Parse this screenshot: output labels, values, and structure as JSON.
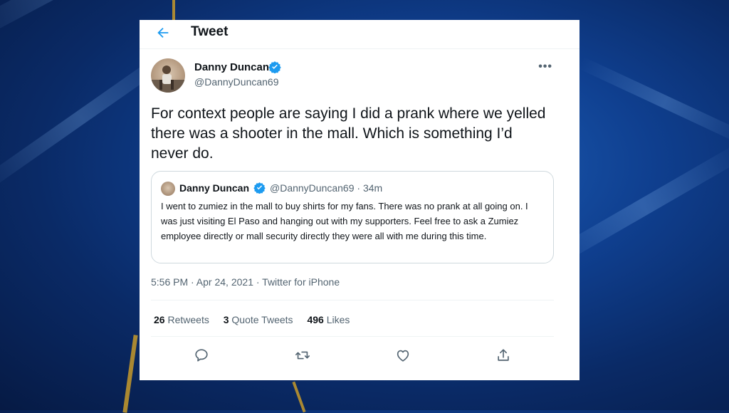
{
  "header": {
    "title": "Tweet"
  },
  "tweet": {
    "author_name": "Danny Duncan",
    "author_handle": "@DannyDuncan69",
    "text": "For context people are saying I did a prank where we yelled there was a shooter in the mall. Which is something I’d never do.",
    "timestamp": "5:56 PM · Apr 24, 2021 · Twitter for iPhone"
  },
  "quote": {
    "author_name": "Danny Duncan",
    "meta": "@DannyDuncan69 · 34m",
    "text": "I went to zumiez in the mall to buy shirts for my fans. There was no prank at all going on. I was just visiting El Paso and hanging out with my supporters. Feel free to ask a Zumiez employee directly or mall security directly they were all with me during this time."
  },
  "stats": {
    "retweets_count": "26",
    "retweets_label": "Retweets",
    "quotes_count": "3",
    "quotes_label": "Quote Tweets",
    "likes_count": "496",
    "likes_label": "Likes"
  },
  "icons": {
    "back": "arrow-left-icon",
    "verified": "verified-badge-icon",
    "more": "more-horizontal-icon",
    "reply": "reply-icon",
    "retweet": "retweet-icon",
    "like": "heart-icon",
    "share": "share-icon"
  },
  "colors": {
    "accent": "#1d9bf0",
    "text": "#0f1419",
    "secondary": "#536471"
  }
}
